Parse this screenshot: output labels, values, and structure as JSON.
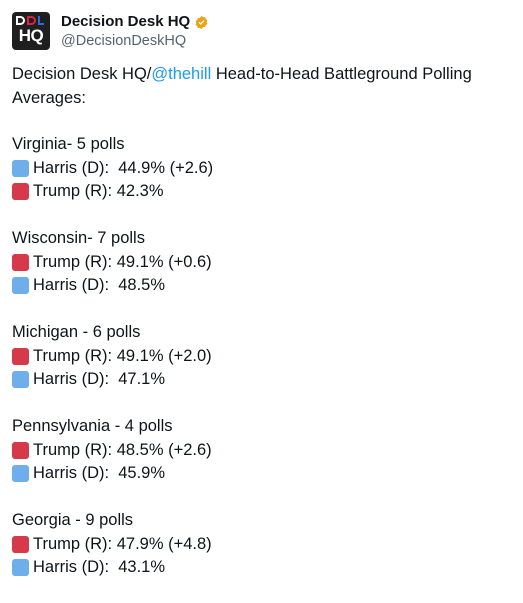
{
  "account": {
    "display_name": "Decision Desk HQ",
    "handle": "@DecisionDeskHQ",
    "avatar_text": "HQ",
    "verified_icon": "verified-badge-icon",
    "verified_color": "#f0b90b"
  },
  "tweet": {
    "intro_prefix": "Decision Desk HQ/",
    "mention": "@thehill",
    "intro_suffix": " Head-to-Head Battleground Polling Averages:",
    "mention_color": "#1d9bf0",
    "states": [
      {
        "title": "Virginia- 5 polls",
        "rows": [
          {
            "swatch": "blue",
            "text": "Harris (D):  44.9% (+2.6)"
          },
          {
            "swatch": "red",
            "text": "Trump (R): 42.3%"
          }
        ]
      },
      {
        "title": "Wisconsin- 7 polls",
        "rows": [
          {
            "swatch": "red",
            "text": "Trump (R): 49.1% (+0.6)"
          },
          {
            "swatch": "blue",
            "text": "Harris (D):  48.5%"
          }
        ]
      },
      {
        "title": "Michigan - 6 polls",
        "rows": [
          {
            "swatch": "red",
            "text": "Trump (R): 49.1% (+2.0)"
          },
          {
            "swatch": "blue",
            "text": "Harris (D):  47.1%"
          }
        ]
      },
      {
        "title": "Pennsylvania - 4 polls",
        "rows": [
          {
            "swatch": "red",
            "text": "Trump (R): 48.5% (+2.6)"
          },
          {
            "swatch": "blue",
            "text": "Harris (D):  45.9%"
          }
        ]
      },
      {
        "title": "Georgia - 9 polls",
        "rows": [
          {
            "swatch": "red",
            "text": "Trump (R): 47.9% (+4.8)"
          },
          {
            "swatch": "blue",
            "text": "Harris (D):  43.1%"
          }
        ]
      }
    ]
  },
  "colors": {
    "democrat_square": "#6eaeea",
    "republican_square": "#d63a4a"
  }
}
